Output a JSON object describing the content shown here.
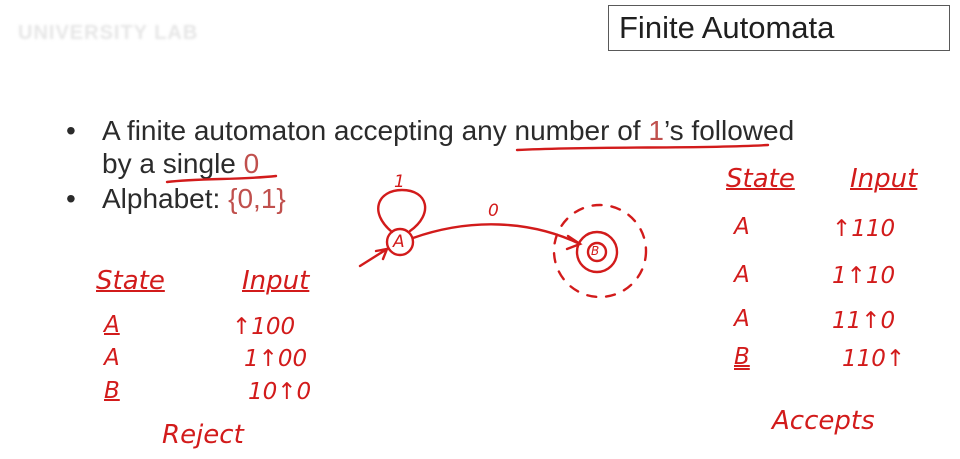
{
  "slide": {
    "watermark": "UNIVERSITY LAB",
    "title": "Finite Automata",
    "bullets": [
      {
        "line1_a": "A finite automaton accepting ",
        "line1_b": "any number of ",
        "line1_c": "1",
        "line1_d": "’s followed",
        "line2_a": "by a ",
        "line2_b": "single ",
        "line2_c": "0"
      },
      {
        "label": "Alphabet: ",
        "value": "{0,1}"
      }
    ]
  },
  "annotations": {
    "diagram": {
      "state_a": "A",
      "state_b": "B",
      "self_loop_label": "1",
      "edge_label": "0"
    },
    "left_trace": {
      "state_header": "State",
      "input_header": "Input",
      "rows": [
        {
          "state": "A",
          "input": "↑100"
        },
        {
          "state": "A",
          "input": "1↑00"
        },
        {
          "state": "B",
          "input": "10↑0"
        }
      ],
      "result": "Reject"
    },
    "right_trace": {
      "state_header": "State",
      "input_header": "Input",
      "rows": [
        {
          "state": "A",
          "input": "↑110"
        },
        {
          "state": "A",
          "input": "1↑10"
        },
        {
          "state": "A",
          "input": "11↑0"
        },
        {
          "state": "B",
          "input": "110↑"
        }
      ],
      "result": "Accepts"
    },
    "colors": {
      "ink": "#d21b1b",
      "accent_text": "#c0504d"
    }
  }
}
